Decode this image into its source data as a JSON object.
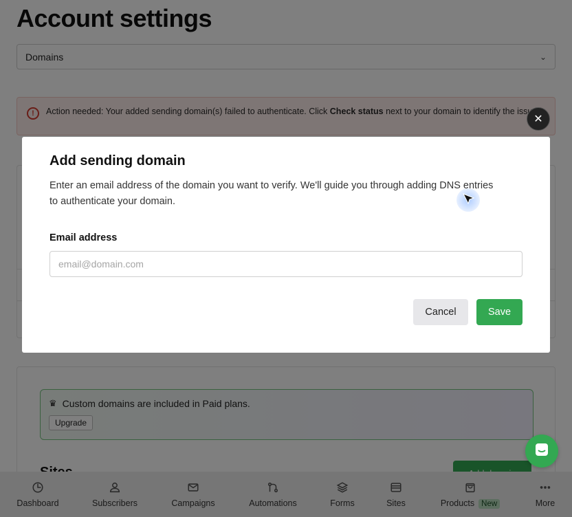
{
  "page": {
    "title": "Account settings",
    "section_select": "Domains"
  },
  "alert": {
    "text_before": "Action needed: Your added sending domain(s) failed to authenticate. Click ",
    "bold": "Check status",
    "text_after": " next to your domain to identify the issue"
  },
  "promo": {
    "text": "Custom domains are included in Paid plans.",
    "upgrade_label": "Upgrade"
  },
  "sites": {
    "heading": "Sites",
    "add_label": "Add domain"
  },
  "modal": {
    "title": "Add sending domain",
    "description": "Enter an email address of the domain you want to verify. We'll guide you through adding DNS entries to authenticate your domain.",
    "email_label": "Email address",
    "email_placeholder": "email@domain.com",
    "email_value": "",
    "cancel_label": "Cancel",
    "save_label": "Save"
  },
  "nav": {
    "items": [
      {
        "label": "Dashboard",
        "icon": "dashboard-icon"
      },
      {
        "label": "Subscribers",
        "icon": "user-icon"
      },
      {
        "label": "Campaigns",
        "icon": "mail-icon"
      },
      {
        "label": "Automations",
        "icon": "automation-icon"
      },
      {
        "label": "Forms",
        "icon": "layers-icon"
      },
      {
        "label": "Sites",
        "icon": "browser-icon"
      },
      {
        "label": "Products",
        "icon": "bag-icon",
        "badge": "New"
      },
      {
        "label": "More",
        "icon": "more-icon"
      }
    ]
  },
  "colors": {
    "brand_green": "#33a852",
    "alert_red": "#d23b2f",
    "overlay": "rgba(0,0,0,0.5)"
  }
}
